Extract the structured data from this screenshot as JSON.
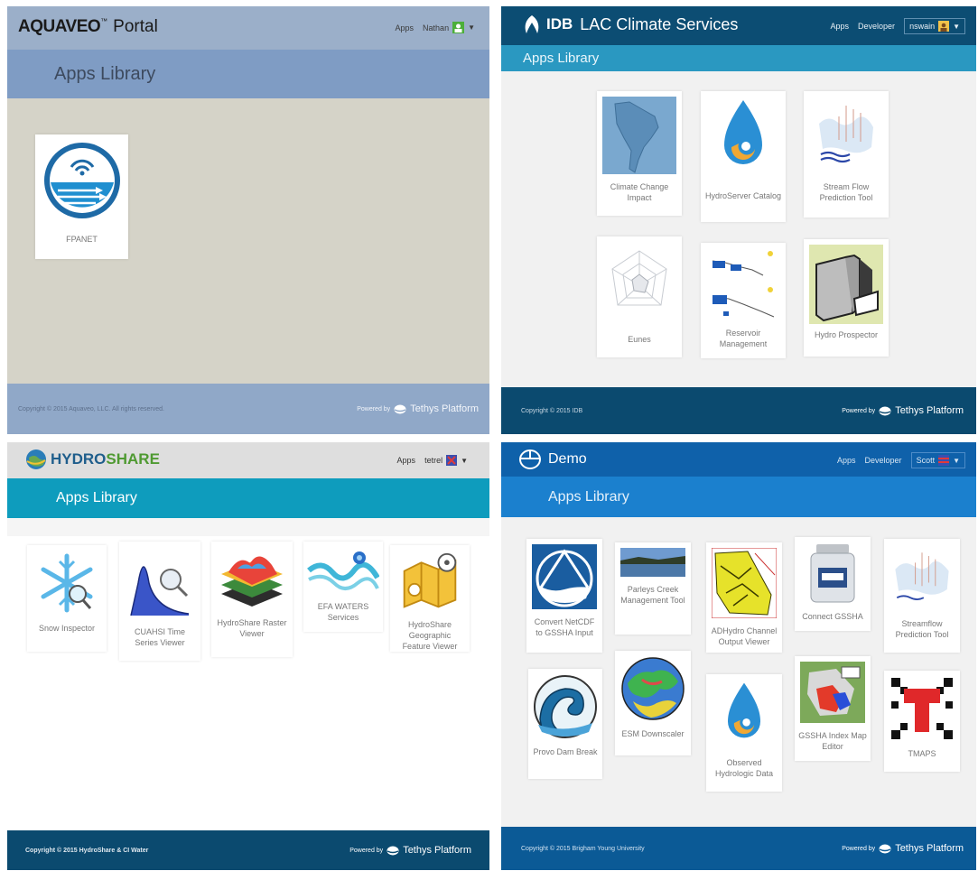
{
  "panels": {
    "aquaveo": {
      "brand": {
        "logo": "AQUAVEO",
        "trademark": "™",
        "title": "Portal"
      },
      "nav": {
        "apps": "Apps",
        "user": "Nathan"
      },
      "section_title": "Apps Library",
      "apps": [
        {
          "label": "FPANET",
          "icon": "fpanet-logo-icon"
        }
      ],
      "footer": {
        "copyright": "Copyright © 2015 Aquaveo, LLC. All rights reserved.",
        "powered_by": "Powered by",
        "platform": "Tethys Platform"
      },
      "colors": {
        "header": "#9bafc9",
        "band": "#7f9cc4",
        "body": "#d5d3c8",
        "footer": "#90a8c8"
      }
    },
    "idb": {
      "brand": {
        "logo": "IDB",
        "title": "LAC Climate Services"
      },
      "nav": {
        "apps": "Apps",
        "developer": "Developer",
        "user": "nswain"
      },
      "section_title": "Apps Library",
      "apps": [
        {
          "label": "Climate Change Impact",
          "icon": "south-america-map-icon"
        },
        {
          "label": "HydroServer Catalog",
          "icon": "water-drop-swirl-icon"
        },
        {
          "label": "Stream Flow Prediction Tool",
          "icon": "stream-flow-icon"
        },
        {
          "label": "Eunes",
          "icon": "radar-chart-icon"
        },
        {
          "label": "Reservoir Management",
          "icon": "reservoir-icon"
        },
        {
          "label": "Hydro Prospector",
          "icon": "hydro-prospector-icon"
        }
      ],
      "footer": {
        "copyright": "Copyright © 2015 IDB",
        "powered_by": "Powered by",
        "platform": "Tethys Platform"
      },
      "colors": {
        "header": "#0c4d73",
        "band": "#2a98c1",
        "body": "#f1f1f1",
        "footer": "#0b4a6f"
      }
    },
    "hydroshare": {
      "brand": {
        "logo_hydro": "HYDRO",
        "logo_share": "SHARE"
      },
      "nav": {
        "apps": "Apps",
        "user": "tetrel"
      },
      "section_title": "Apps Library",
      "apps": [
        {
          "label": "Snow Inspector",
          "icon": "snowflake-icon"
        },
        {
          "label": "CUAHSI Time Series Viewer",
          "icon": "time-series-icon"
        },
        {
          "label": "HydroShare Raster Viewer",
          "icon": "raster-layers-icon"
        },
        {
          "label": "EFA WATERS Services",
          "icon": "river-icon"
        },
        {
          "label": "HydroShare Geographic Feature Viewer",
          "icon": "map-feature-icon"
        }
      ],
      "footer": {
        "copyright": "Copyright © 2015 HydroShare & CI Water",
        "powered_by": "Powered by",
        "platform": "Tethys Platform"
      },
      "colors": {
        "header": "#dedede",
        "band": "#0e9cbd",
        "body": "#ffffff",
        "footer": "#0b4a6f"
      }
    },
    "demo": {
      "brand": {
        "title": "Demo"
      },
      "nav": {
        "apps": "Apps",
        "developer": "Developer",
        "user": "Scott"
      },
      "section_title": "Apps Library",
      "apps": [
        {
          "label": "Convert NetCDF to GSSHA Input",
          "icon": "netcdf-convert-icon"
        },
        {
          "label": "Parleys Creek Management Tool",
          "icon": "lake-photo-icon"
        },
        {
          "label": "ADHydro Channel Output Viewer",
          "icon": "adhydro-map-icon"
        },
        {
          "label": "Connect GSSHA",
          "icon": "jar-icon"
        },
        {
          "label": "Streamflow Prediction Tool",
          "icon": "stream-flow-icon"
        },
        {
          "label": "Provo Dam Break",
          "icon": "wave-icon"
        },
        {
          "label": "ESM Downscaler",
          "icon": "globe-icon"
        },
        {
          "label": "Observed Hydrologic Data",
          "icon": "water-drop-swirl-icon"
        },
        {
          "label": "GSSHA Index Map Editor",
          "icon": "index-map-icon"
        },
        {
          "label": "TMAPS",
          "icon": "tmaps-icon"
        }
      ],
      "footer": {
        "copyright": "Copyright © 2015 Brigham Young University",
        "powered_by": "Powered by",
        "platform": "Tethys Platform"
      },
      "colors": {
        "header": "#0f61aa",
        "band": "#1b80ce",
        "body": "#f1f1f1",
        "footer": "#0b5a96"
      }
    }
  }
}
